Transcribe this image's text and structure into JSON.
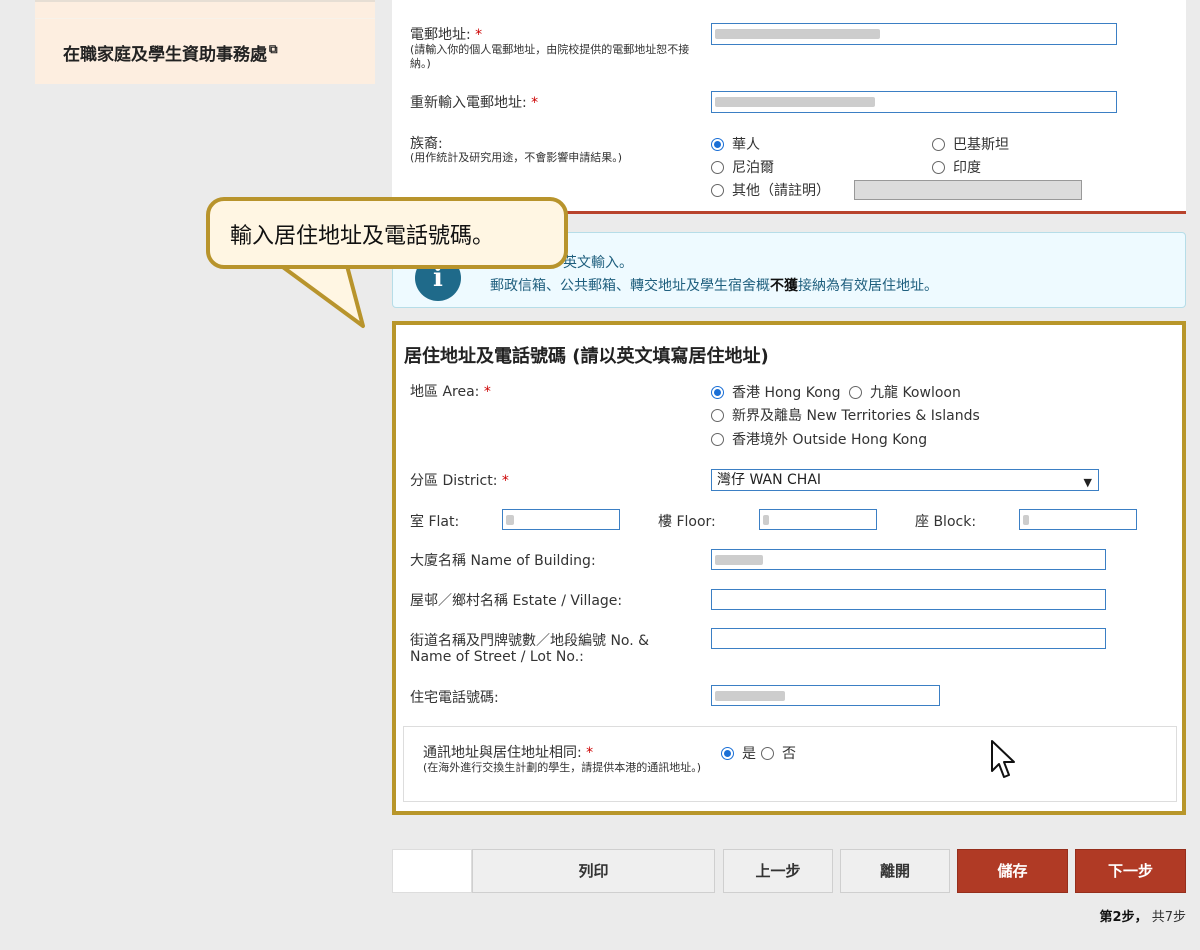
{
  "sidebar": {
    "link_label": "在職家庭及學生資助事務處",
    "link_icon": "external-link-icon"
  },
  "personal": {
    "email_label": "電郵地址:",
    "email_hint": "(請輸入你的個人電郵地址，由院校提供的電郵地址恕不接納。)",
    "email_confirm_label": "重新輸入電郵地址:",
    "required_mark": "*",
    "ethnicity_label": "族裔:",
    "ethnicity_hint": "(用作統計及研究用途，不會影響申請結果。)",
    "ethnicity_options": [
      "華人",
      "巴基斯坦",
      "尼泊爾",
      "印度",
      "其他（請註明）"
    ],
    "ethnicity_selected": "華人"
  },
  "info": {
    "line1": "英文輸入。",
    "line2_pre": "郵政信箱、公共郵箱、轉交地址及學生宿舍概",
    "line2_bold": "不獲",
    "line2_post": "接納為有效居住地址。",
    "icon": "info-icon"
  },
  "callout": {
    "text": "輸入居住地址及電話號碼。"
  },
  "address": {
    "title": "居住地址及電話號碼 (請以英文填寫居住地址)",
    "area_label": "地區 Area:",
    "area_options": [
      "香港 Hong Kong",
      "九龍 Kowloon",
      "新界及離島 New Territories & Islands",
      "香港境外 Outside Hong Kong"
    ],
    "area_selected": "香港 Hong Kong",
    "district_label": "分區 District:",
    "district_value": "灣仔 WAN CHAI",
    "flat_label": "室 Flat:",
    "floor_label": "樓 Floor:",
    "block_label": "座 Block:",
    "building_label": "大廈名稱 Name of Building:",
    "estate_label": "屋邨／鄉村名稱 Estate / Village:",
    "street_label_1": "街道名稱及門牌號數／地段編號 No. &",
    "street_label_2": "Name of Street / Lot No.:",
    "phone_label": "住宅電話號碼:",
    "same_label": "通訊地址與居住地址相同:",
    "same_hint": "(在海外進行交換生計劃的學生，請提供本港的通訊地址。)",
    "same_options": [
      "是",
      "否"
    ],
    "same_selected": "是"
  },
  "buttons": {
    "print": "列印",
    "back": "上一步",
    "leave": "離開",
    "save": "儲存",
    "next": "下一步"
  },
  "steps": {
    "current": "第2步，",
    "total": "共7步"
  },
  "colors": {
    "accent_red": "#b03a25",
    "highlight_gold": "#b8962a",
    "input_blue": "#3b7fc4"
  }
}
